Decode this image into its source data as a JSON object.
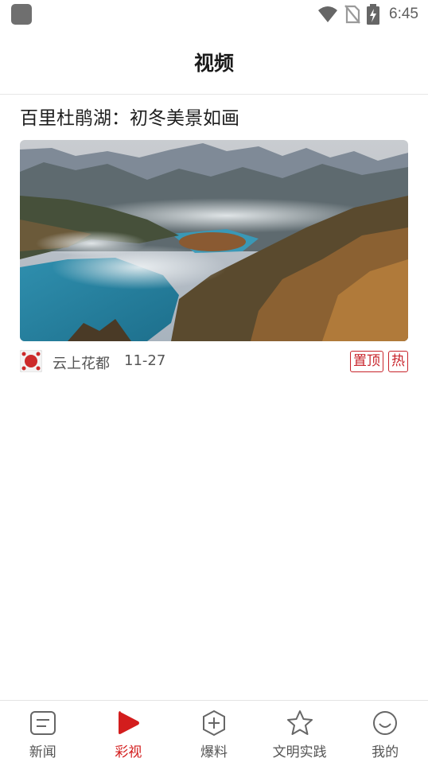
{
  "status_bar": {
    "time": "6:45",
    "icons": [
      "app-indicator-icon",
      "wifi-icon",
      "no-sim-icon",
      "battery-charging-icon"
    ]
  },
  "header": {
    "title": "视频"
  },
  "articles": [
    {
      "title": "百里杜鹃湖：初冬美景如画",
      "source": "云上花都",
      "date": "11-27",
      "tags": [
        "置顶",
        "热"
      ]
    }
  ],
  "bottom_nav": {
    "items": [
      {
        "label": "新闻",
        "icon": "news-icon",
        "active": false
      },
      {
        "label": "彩视",
        "icon": "play-icon",
        "active": true
      },
      {
        "label": "爆料",
        "icon": "add-shield-icon",
        "active": false
      },
      {
        "label": "文明实践",
        "icon": "star-icon",
        "active": false
      },
      {
        "label": "我的",
        "icon": "smile-icon",
        "active": false
      }
    ]
  },
  "colors": {
    "accent": "#d31d1d",
    "tag": "#c8242b",
    "icon_gray": "#666666"
  }
}
